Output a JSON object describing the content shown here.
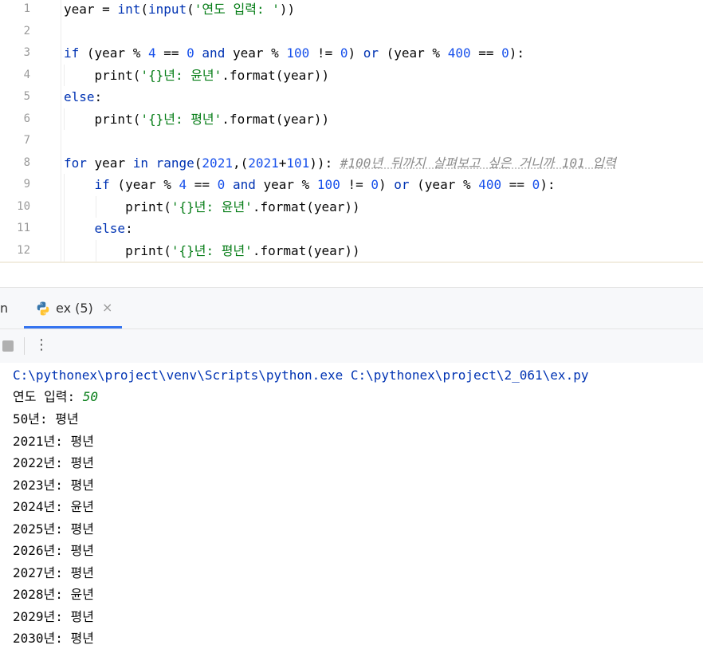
{
  "editor": {
    "line_numbers": [
      "1",
      "2",
      "3",
      "4",
      "5",
      "6",
      "7",
      "8",
      "9",
      "10",
      "11",
      "12"
    ],
    "lines": [
      [
        {
          "t": "year = ",
          "c": ""
        },
        {
          "t": "int",
          "c": "kw"
        },
        {
          "t": "(",
          "c": ""
        },
        {
          "t": "input",
          "c": "kw"
        },
        {
          "t": "(",
          "c": ""
        },
        {
          "t": "'연도 입력: '",
          "c": "str"
        },
        {
          "t": "))",
          "c": ""
        }
      ],
      [],
      [
        {
          "t": "if",
          "c": "kw"
        },
        {
          "t": " (year % ",
          "c": ""
        },
        {
          "t": "4",
          "c": "num"
        },
        {
          "t": " == ",
          "c": ""
        },
        {
          "t": "0",
          "c": "num"
        },
        {
          "t": " ",
          "c": ""
        },
        {
          "t": "and",
          "c": "kw"
        },
        {
          "t": " year % ",
          "c": ""
        },
        {
          "t": "100",
          "c": "num"
        },
        {
          "t": " != ",
          "c": ""
        },
        {
          "t": "0",
          "c": "num"
        },
        {
          "t": ") ",
          "c": ""
        },
        {
          "t": "or",
          "c": "kw"
        },
        {
          "t": " (year % ",
          "c": ""
        },
        {
          "t": "400",
          "c": "num"
        },
        {
          "t": " == ",
          "c": ""
        },
        {
          "t": "0",
          "c": "num"
        },
        {
          "t": "):",
          "c": ""
        }
      ],
      [
        {
          "t": "    print(",
          "c": ""
        },
        {
          "t": "'{}년: 윤년'",
          "c": "str"
        },
        {
          "t": ".format(year))",
          "c": ""
        }
      ],
      [
        {
          "t": "else",
          "c": "kw"
        },
        {
          "t": ":",
          "c": ""
        }
      ],
      [
        {
          "t": "    print(",
          "c": ""
        },
        {
          "t": "'{}년: 평년'",
          "c": "str"
        },
        {
          "t": ".format(year))",
          "c": ""
        }
      ],
      [],
      [
        {
          "t": "for",
          "c": "kw"
        },
        {
          "t": " year ",
          "c": ""
        },
        {
          "t": "in",
          "c": "kw"
        },
        {
          "t": " ",
          "c": ""
        },
        {
          "t": "range",
          "c": "kw"
        },
        {
          "t": "(",
          "c": ""
        },
        {
          "t": "2021",
          "c": "num"
        },
        {
          "t": ",(",
          "c": ""
        },
        {
          "t": "2021",
          "c": "num"
        },
        {
          "t": "+",
          "c": ""
        },
        {
          "t": "101",
          "c": "num"
        },
        {
          "t": ")): ",
          "c": ""
        },
        {
          "t": "#100년 뒤까지 살펴보고 싶은 거니까 101 입력",
          "c": "cmt"
        }
      ],
      [
        {
          "t": "    ",
          "c": ""
        },
        {
          "t": "if",
          "c": "kw"
        },
        {
          "t": " (year % ",
          "c": ""
        },
        {
          "t": "4",
          "c": "num"
        },
        {
          "t": " == ",
          "c": ""
        },
        {
          "t": "0",
          "c": "num"
        },
        {
          "t": " ",
          "c": ""
        },
        {
          "t": "and",
          "c": "kw"
        },
        {
          "t": " year % ",
          "c": ""
        },
        {
          "t": "100",
          "c": "num"
        },
        {
          "t": " != ",
          "c": ""
        },
        {
          "t": "0",
          "c": "num"
        },
        {
          "t": ") ",
          "c": ""
        },
        {
          "t": "or",
          "c": "kw"
        },
        {
          "t": " (year % ",
          "c": ""
        },
        {
          "t": "400",
          "c": "num"
        },
        {
          "t": " == ",
          "c": ""
        },
        {
          "t": "0",
          "c": "num"
        },
        {
          "t": "):",
          "c": ""
        }
      ],
      [
        {
          "t": "        print(",
          "c": ""
        },
        {
          "t": "'{}년: 윤년'",
          "c": "str"
        },
        {
          "t": ".format(year))",
          "c": ""
        }
      ],
      [
        {
          "t": "    ",
          "c": ""
        },
        {
          "t": "else",
          "c": "kw"
        },
        {
          "t": ":",
          "c": ""
        }
      ],
      [
        {
          "t": "        print(",
          "c": ""
        },
        {
          "t": "'{}년: 평년'",
          "c": "str"
        },
        {
          "t": ".format(year))",
          "c": ""
        }
      ]
    ]
  },
  "run_panel": {
    "partial_tab_label": "n",
    "active_tab": {
      "label": "ex (5)",
      "close_glyph": "×",
      "icon": "python-icon"
    },
    "toolbar": {
      "stop_icon": "stop-icon",
      "more_icon": "more-vertical-icon",
      "more_glyph": "⋮"
    }
  },
  "console": {
    "command": "C:\\pythonex\\project\\venv\\Scripts\\python.exe C:\\pythonex\\project\\2_061\\ex.py",
    "prompt": "연도 입력: ",
    "user_input": "50",
    "output_lines": [
      "50년: 평년",
      "2021년: 평년",
      "2022년: 평년",
      "2023년: 평년",
      "2024년: 윤년",
      "2025년: 평년",
      "2026년: 평년",
      "2027년: 평년",
      "2028년: 윤년",
      "2029년: 평년",
      "2030년: 평년"
    ]
  },
  "colors": {
    "keyword": "#0033b3",
    "string": "#067d17",
    "number": "#1750eb",
    "comment": "#8c8c8c",
    "tab_underline": "#3574f0"
  }
}
